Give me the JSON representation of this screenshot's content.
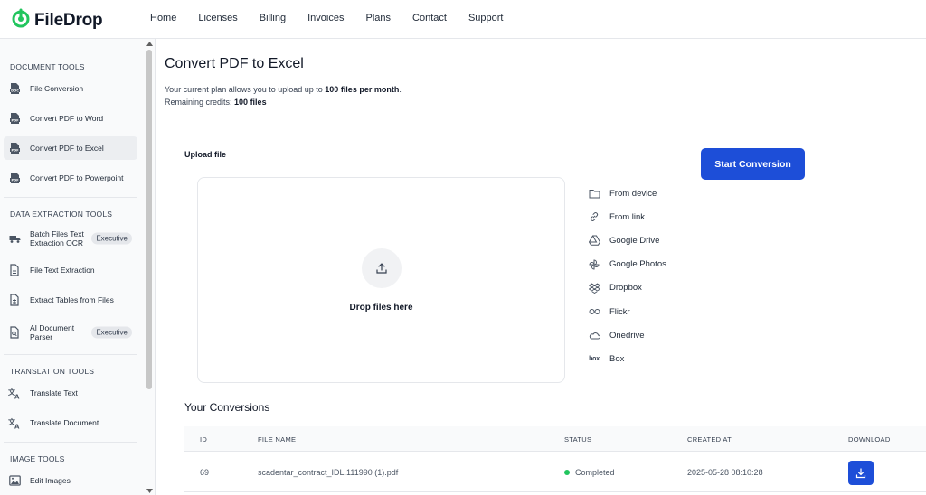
{
  "brand": {
    "name": "FileDrop",
    "accent": "#22c55e"
  },
  "nav": [
    "Home",
    "Licenses",
    "Billing",
    "Invoices",
    "Plans",
    "Contact",
    "Support"
  ],
  "sidebar": {
    "sections": [
      {
        "title": "DOCUMENT TOOLS"
      },
      {
        "title": "DATA EXTRACTION TOOLS"
      },
      {
        "title": "TRANSLATION TOOLS"
      },
      {
        "title": "IMAGE TOOLS"
      }
    ],
    "items": [
      {
        "label": "File Conversion",
        "icon": "doc-file-icon"
      },
      {
        "label": "Convert PDF to Word",
        "icon": "pdf-file-icon"
      },
      {
        "label": "Convert PDF to Excel",
        "icon": "pdf-file-icon",
        "active": true
      },
      {
        "label": "Convert PDF to Powerpoint",
        "icon": "pdf-file-icon"
      },
      {
        "label": "Batch Files Text Extraction OCR",
        "icon": "truck-icon",
        "badge": "Executive"
      },
      {
        "label": "File Text Extraction",
        "icon": "file-text-icon"
      },
      {
        "label": "Extract Tables from Files",
        "icon": "table-file-icon"
      },
      {
        "label": "AI Document Parser",
        "icon": "file-search-icon",
        "badge": "Executive"
      },
      {
        "label": "Translate Text",
        "icon": "translate-icon"
      },
      {
        "label": "Translate Document",
        "icon": "translate-icon"
      },
      {
        "label": "Edit Images",
        "icon": "image-icon"
      }
    ]
  },
  "main": {
    "title": "Convert PDF to Excel",
    "plan_prefix": "Your current plan allows you to upload up to ",
    "plan_limit": "100 files per month",
    "plan_suffix": ".",
    "credits_prefix": "Remaining credits: ",
    "credits_value": "100 files",
    "upload_label": "Upload file",
    "start_button": "Start Conversion",
    "drop_text": "Drop files here",
    "sources": [
      {
        "label": "From device",
        "icon": "folder-icon"
      },
      {
        "label": "From link",
        "icon": "link-icon"
      },
      {
        "label": "Google Drive",
        "icon": "google-drive-icon"
      },
      {
        "label": "Google Photos",
        "icon": "google-photos-icon"
      },
      {
        "label": "Dropbox",
        "icon": "dropbox-icon"
      },
      {
        "label": "Flickr",
        "icon": "flickr-icon"
      },
      {
        "label": "Onedrive",
        "icon": "onedrive-icon"
      },
      {
        "label": "Box",
        "icon": "box-icon",
        "glyph": "box"
      }
    ]
  },
  "conversions": {
    "title": "Your Conversions",
    "columns": [
      "ID",
      "FILE NAME",
      "STATUS",
      "CREATED AT",
      "DOWNLOAD"
    ],
    "rows": [
      {
        "id": "69",
        "file_name": "scadentar_contract_IDL.111990 (1).pdf",
        "status": "Completed",
        "created_at": "2025-05-28 08:10:28"
      }
    ]
  }
}
